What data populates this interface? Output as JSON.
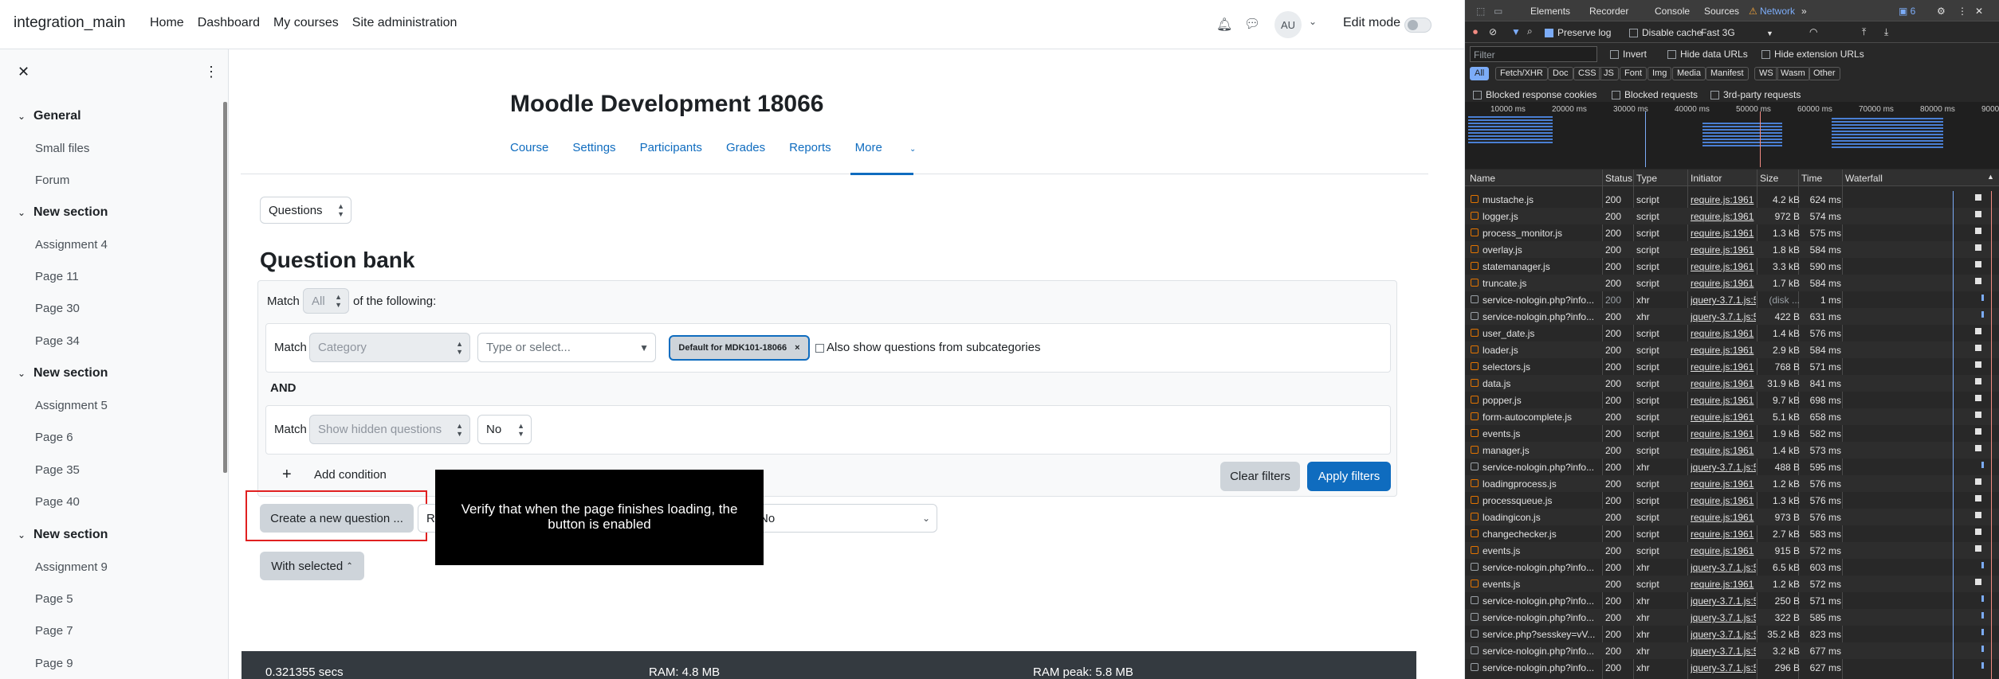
{
  "navbar": {
    "brand": "integration_main",
    "links": [
      "Home",
      "Dashboard",
      "My courses",
      "Site administration"
    ],
    "avatar": "AU",
    "edit_mode": "Edit mode"
  },
  "drawer": {
    "sections": [
      {
        "title": "General",
        "items": [
          "Small files",
          "Forum"
        ]
      },
      {
        "title": "New section",
        "items": [
          "Assignment 4",
          "Page 11",
          "Page 30",
          "Page 34"
        ]
      },
      {
        "title": "New section",
        "items": [
          "Assignment 5",
          "Page 6",
          "Page 35",
          "Page 40"
        ]
      },
      {
        "title": "New section",
        "items": [
          "Assignment 9",
          "Page 5",
          "Page 7",
          "Page 9"
        ]
      }
    ]
  },
  "course": {
    "title": "Moodle Development 18066",
    "tabs": [
      "Course",
      "Settings",
      "Participants",
      "Grades",
      "Reports",
      "More"
    ]
  },
  "qbank": {
    "nav_select": "Questions",
    "heading": "Question bank",
    "match_label": "Match",
    "match_all": "All",
    "of_following": "of the following:",
    "category_label": "Category",
    "type_placeholder": "Type or select...",
    "chip": "Default for MDK101-18066",
    "subcats": "Also show questions from subcategories",
    "and_label": "AND",
    "hidden_label": "Show hidden questions",
    "hidden_value": "No",
    "add_condition": "Add condition",
    "clear_filters": "Clear filters",
    "apply_filters": "Apply filters",
    "create_button": "Create a new question ...",
    "partial_select": "R",
    "partial_select2": "No",
    "with_selected": "With selected"
  },
  "tooltip": "Verify that when the page finishes loading, the button is enabled",
  "footer": {
    "time": "0.321355 secs",
    "ram": "RAM: 4.8 MB",
    "ram_peak": "RAM peak: 5.8 MB"
  },
  "devtools": {
    "tabs": [
      "Elements",
      "Recorder",
      "Console",
      "Sources",
      "Network"
    ],
    "issues": "6",
    "preserve_log": "Preserve log",
    "disable_cache": "Disable cache",
    "throttle": "Fast 3G",
    "filter_placeholder": "Filter",
    "invert": "Invert",
    "hide_data_urls": "Hide data URLs",
    "hide_ext_urls": "Hide extension URLs",
    "type_filters": [
      "All",
      "Fetch/XHR",
      "Doc",
      "CSS",
      "JS",
      "Font",
      "Img",
      "Media",
      "Manifest",
      "WS",
      "Wasm",
      "Other"
    ],
    "blocked_cookies": "Blocked response cookies",
    "blocked_requests": "Blocked requests",
    "third_party": "3rd-party requests",
    "timeline_labels": [
      "10000 ms",
      "20000 ms",
      "30000 ms",
      "40000 ms",
      "50000 ms",
      "60000 ms",
      "70000 ms",
      "80000 ms",
      "9000"
    ],
    "columns": [
      "Name",
      "Status",
      "Type",
      "Initiator",
      "Size",
      "Time",
      "Waterfall"
    ],
    "rows": [
      [
        "mustache.js",
        "200",
        "script",
        "require.js:1961",
        "4.2 kB",
        "624 ms"
      ],
      [
        "logger.js",
        "200",
        "script",
        "require.js:1961",
        "972 B",
        "574 ms"
      ],
      [
        "process_monitor.js",
        "200",
        "script",
        "require.js:1961",
        "1.3 kB",
        "575 ms"
      ],
      [
        "overlay.js",
        "200",
        "script",
        "require.js:1961",
        "1.8 kB",
        "584 ms"
      ],
      [
        "statemanager.js",
        "200",
        "script",
        "require.js:1961",
        "3.3 kB",
        "590 ms"
      ],
      [
        "truncate.js",
        "200",
        "script",
        "require.js:1961",
        "1.7 kB",
        "584 ms"
      ],
      [
        "service-nologin.php?info...",
        "200",
        "xhr",
        "jquery-3.7.1.js:5",
        "(disk ...",
        "1 ms"
      ],
      [
        "service-nologin.php?info...",
        "200",
        "xhr",
        "jquery-3.7.1.js:5",
        "422 B",
        "631 ms"
      ],
      [
        "user_date.js",
        "200",
        "script",
        "require.js:1961",
        "1.4 kB",
        "576 ms"
      ],
      [
        "loader.js",
        "200",
        "script",
        "require.js:1961",
        "2.9 kB",
        "584 ms"
      ],
      [
        "selectors.js",
        "200",
        "script",
        "require.js:1961",
        "768 B",
        "571 ms"
      ],
      [
        "data.js",
        "200",
        "script",
        "require.js:1961",
        "31.9 kB",
        "841 ms"
      ],
      [
        "popper.js",
        "200",
        "script",
        "require.js:1961",
        "9.7 kB",
        "698 ms"
      ],
      [
        "form-autocomplete.js",
        "200",
        "script",
        "require.js:1961",
        "5.1 kB",
        "658 ms"
      ],
      [
        "events.js",
        "200",
        "script",
        "require.js:1961",
        "1.9 kB",
        "582 ms"
      ],
      [
        "manager.js",
        "200",
        "script",
        "require.js:1961",
        "1.4 kB",
        "573 ms"
      ],
      [
        "service-nologin.php?info...",
        "200",
        "xhr",
        "jquery-3.7.1.js:5",
        "488 B",
        "595 ms"
      ],
      [
        "loadingprocess.js",
        "200",
        "script",
        "require.js:1961",
        "1.2 kB",
        "576 ms"
      ],
      [
        "processqueue.js",
        "200",
        "script",
        "require.js:1961",
        "1.3 kB",
        "576 ms"
      ],
      [
        "loadingicon.js",
        "200",
        "script",
        "require.js:1961",
        "973 B",
        "576 ms"
      ],
      [
        "changechecker.js",
        "200",
        "script",
        "require.js:1961",
        "2.7 kB",
        "583 ms"
      ],
      [
        "events.js",
        "200",
        "script",
        "require.js:1961",
        "915 B",
        "572 ms"
      ],
      [
        "service-nologin.php?info...",
        "200",
        "xhr",
        "jquery-3.7.1.js:5",
        "6.5 kB",
        "603 ms"
      ],
      [
        "events.js",
        "200",
        "script",
        "require.js:1961",
        "1.2 kB",
        "572 ms"
      ],
      [
        "service-nologin.php?info...",
        "200",
        "xhr",
        "jquery-3.7.1.js:5",
        "250 B",
        "571 ms"
      ],
      [
        "service-nologin.php?info...",
        "200",
        "xhr",
        "jquery-3.7.1.js:5",
        "322 B",
        "585 ms"
      ],
      [
        "service.php?sesskey=vV...",
        "200",
        "xhr",
        "jquery-3.7.1.js:5",
        "35.2 kB",
        "823 ms"
      ],
      [
        "service-nologin.php?info...",
        "200",
        "xhr",
        "jquery-3.7.1.js:5",
        "3.2 kB",
        "677 ms"
      ],
      [
        "service-nologin.php?info...",
        "200",
        "xhr",
        "jquery-3.7.1.js:5",
        "296 B",
        "627 ms"
      ]
    ]
  },
  "colors": {
    "primary": "#0f6cbf",
    "highlight": "#e02020",
    "devtools_accent": "#7cacf8"
  }
}
